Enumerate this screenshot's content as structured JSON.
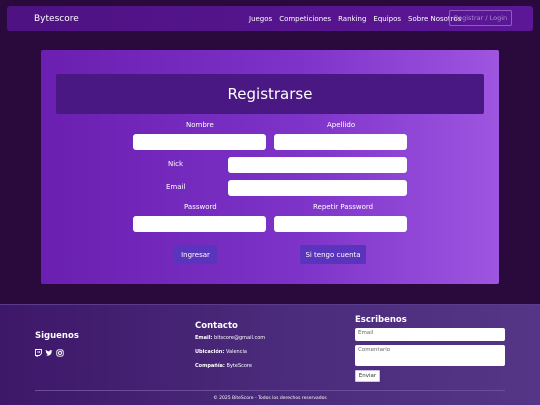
{
  "navbar": {
    "brand": "Bytescore",
    "links": [
      "Juegos",
      "Competiciones",
      "Ranking",
      "Equipos",
      "Sobre Nosotros"
    ],
    "login": "Registrar / Login"
  },
  "form": {
    "title": "Registrarse",
    "labels": {
      "nombre": "Nombre",
      "apellido": "Apellido",
      "nick": "Nick",
      "email": "Email",
      "password": "Password",
      "repeat_password": "Repetir Password"
    },
    "buttons": {
      "submit": "Ingresar",
      "has_account": "Si tengo cuenta"
    }
  },
  "footer": {
    "follow": {
      "title": "Siguenos",
      "icons": [
        "twitch-icon",
        "twitter-icon",
        "instagram-icon"
      ]
    },
    "contact": {
      "title": "Contacto",
      "email_label": "Email:",
      "email_value": "bitscore@gmail.com",
      "location_label": "Ubicación:",
      "location_value": "Valencia",
      "company_label": "Compañía:",
      "company_value": "ByteScore"
    },
    "write": {
      "title": "Escribenos",
      "email_placeholder": "Email",
      "comment_placeholder": "Comentario",
      "send": "Enviar"
    },
    "copyright": "© 2025 BiteScore - Todos los derechos reservados"
  }
}
